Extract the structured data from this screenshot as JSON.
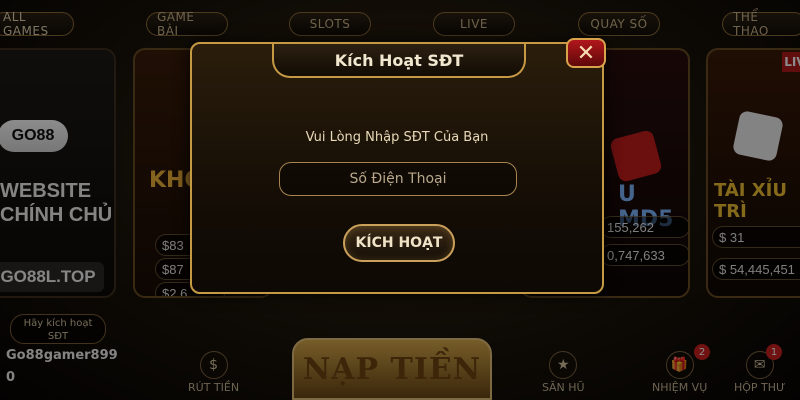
{
  "tabs": [
    "ALL GAMES",
    "GAME BÀI",
    "SLOTS",
    "LIVE",
    "QUAY SỐ",
    "THỂ THAO"
  ],
  "left_panel": {
    "logo": "GO88",
    "website_lines": [
      "WEBSITE",
      "CHÍNH CHỦ"
    ],
    "url": "GO88L.TOP",
    "activate_pill": [
      "Hãy kích hoạt",
      "SĐT"
    ],
    "username": "Go88gamer899",
    "balance": "0"
  },
  "cards": [
    {
      "partial_title": "KHO",
      "values": [
        "$83",
        "$87",
        "$2,6"
      ]
    },
    {
      "partial_title": "U MD5",
      "values": [
        "155,262",
        "0,747,633"
      ]
    },
    {
      "partial_title": "TÀI XỈU TRÌ",
      "live_badge": "LIVE",
      "values": [
        "$ 31",
        "$ 54,445,451"
      ]
    }
  ],
  "bottom": {
    "rut_tien": "RÚT TIỀN",
    "nap_tien": "NẠP TIỀN",
    "san_hu": "SĂN HŨ",
    "nhiem_vu": "NHIỆM VỤ",
    "nhiem_vu_badge": "2",
    "hop_thu": "HỘP THƯ",
    "hop_thu_badge": "1"
  },
  "modal": {
    "title": "Kích Hoạt SĐT",
    "prompt": "Vui Lòng Nhập SĐT Của Bạn",
    "input_placeholder": "Số Điện Thoại",
    "activate_label": "KÍCH HOẠT",
    "close_symbol": "✕"
  },
  "colors": {
    "gold": "#c69a44",
    "close_red": "#b1171b"
  }
}
